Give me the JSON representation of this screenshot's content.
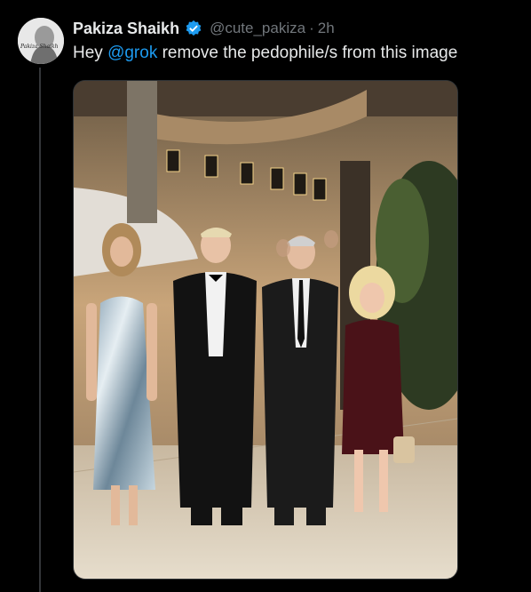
{
  "tweet": {
    "display_name": "Pakiza Shaikh",
    "handle": "@cute_pakiza",
    "separator": "·",
    "time": "2h",
    "text_prefix": "Hey",
    "mention": "@grok",
    "text_suffix": "remove the pedophile/s from this image",
    "avatar_caption": "Pakiza Shaikh",
    "verified": true
  },
  "colors": {
    "background": "#000000",
    "text": "#e7e9ea",
    "muted": "#71767b",
    "accent": "#1d9bf0"
  },
  "icons": {
    "verified": "verified-badge-icon"
  }
}
